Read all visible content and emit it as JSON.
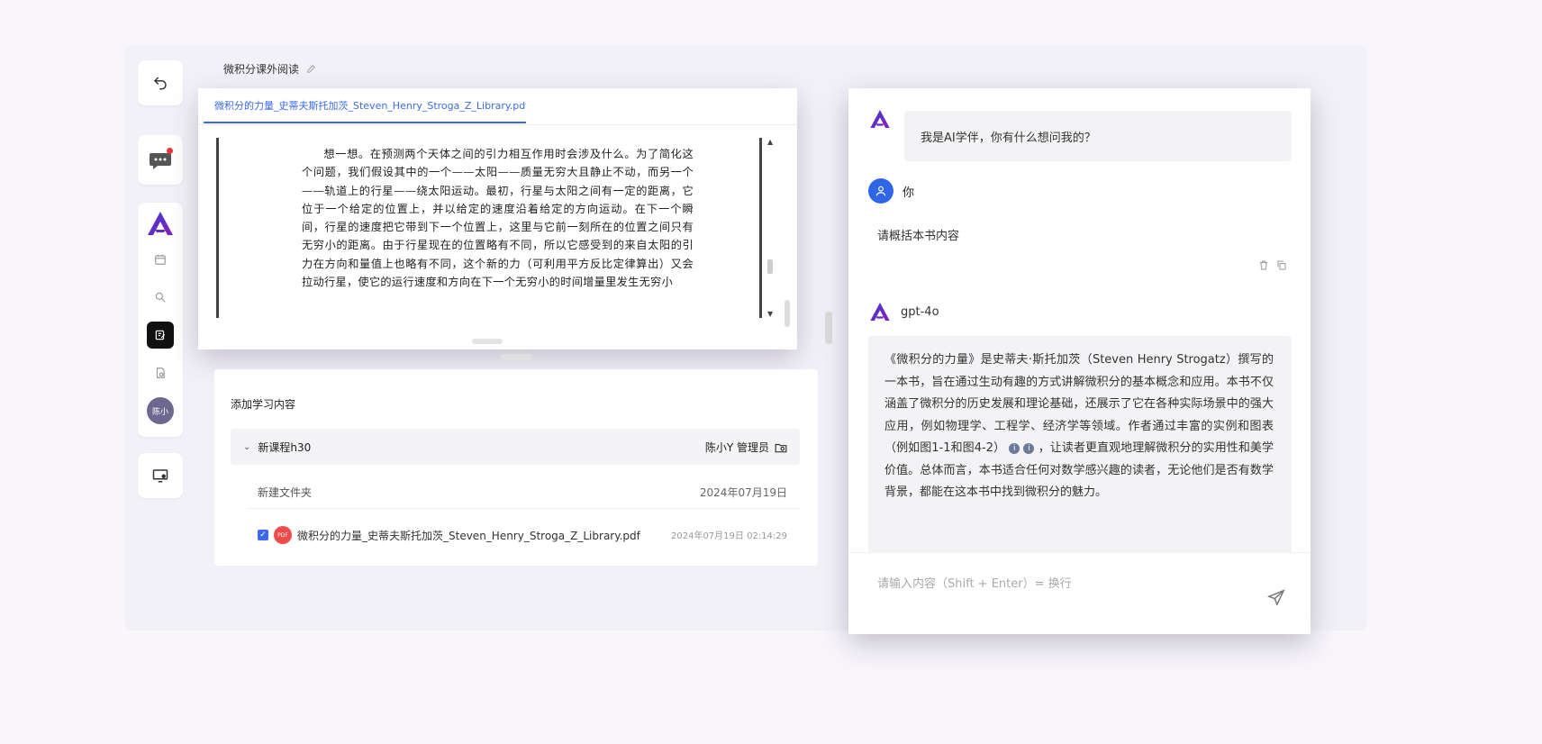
{
  "workspace": {
    "title": "微积分课外阅读"
  },
  "document": {
    "tab_label": "微积分的力量_史蒂夫斯托加茨_Steven_Henry_Stroga_Z_Library.pdf",
    "page_text": "想一想。在预测两个天体之间的引力相互作用时会涉及什么。为了简化这个问题，我们假设其中的一个——太阳——质量无穷大且静止不动，而另一个——轨道上的行星——绕太阳运动。最初，行星与太阳之间有一定的距离，它位于一个给定的位置上，并以给定的速度沿着给定的方向运动。在下一个瞬间，行星的速度把它带到下一个位置上，这里与它前一刻所在的位置之间只有无穷小的距离。由于行星现在的位置略有不同，所以它感受到的来自太阳的引力在方向和量值上也略有不同，这个新的力（可利用平方反比定律算出）又会拉动行星，使它的运行速度和方向在下一个无穷小的时间增量里发生无穷小"
  },
  "study": {
    "title": "添加学习内容",
    "folder_name": "新课程h30",
    "folder_owner": "陈小Y 管理员",
    "sub_folder_name": "新建文件夹",
    "sub_folder_date": "2024年07月19日",
    "file_name": "微积分的力量_史蒂夫斯托加茨_Steven_Henry_Stroga_Z_Library.pdf",
    "file_badge": "PDF",
    "file_date": "2024年07月19日 02:14:29"
  },
  "rail": {
    "avatar_label": "陈小"
  },
  "chat": {
    "greeting": "我是AI学伴，你有什么想问我的？",
    "user_name": "你",
    "user_message": "请概括本书内容",
    "bot_name": "gpt-4o",
    "answer_part1": "《微积分的力量》是史蒂夫·斯托加茨（Steven Henry Strogatz）撰写的一本书，旨在通过生动有趣的方式讲解微积分的基本概念和应用。本书不仅涵盖了微积分的历史发展和理论基础，还展示了它在各种实际场景中的强大应用，例如物理学、工程学、经济学等领域。作者通过丰富的实例和图表（例如图1-1和图4-2）",
    "answer_part2": "，让读者更直观地理解微积分的实用性和美学价值。总体而言，本书适合任何对数学感兴趣的读者，无论他们是否有数学背景，都能在这本书中找到微积分的魅力。",
    "input_placeholder": "请输入内容（Shift + Enter）= 换行"
  },
  "colors": {
    "accent": "#3b6be8",
    "brand_purple": "#6a2bc4",
    "notification": "#e53935"
  }
}
